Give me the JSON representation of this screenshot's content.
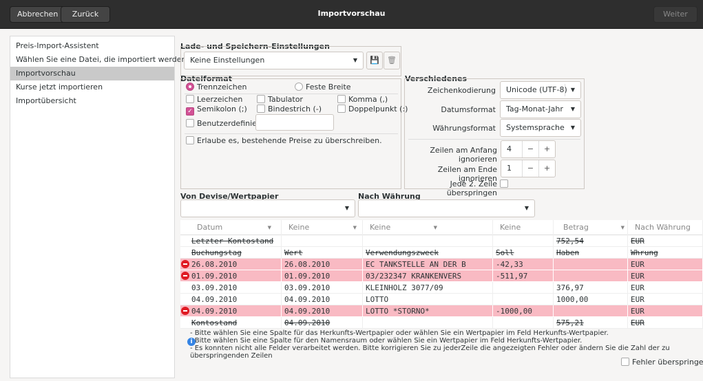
{
  "titlebar": {
    "cancel": "Abbrechen",
    "back": "Zurück",
    "title": "Importvorschau",
    "next": "Weiter"
  },
  "sidebar": {
    "items": [
      {
        "label": "Preis-Import-Assistent"
      },
      {
        "label": "Wählen Sie eine Datei, die importiert werden soll"
      },
      {
        "label": "Importvorschau"
      },
      {
        "label": "Kurse jetzt importieren"
      },
      {
        "label": "Importübersicht"
      }
    ]
  },
  "load_save": {
    "label": "Lade- und Speichern-Einstellungen",
    "value": "Keine Einstellungen"
  },
  "fileformat": {
    "label": "Dateiformat",
    "separated": "Trennzeichen",
    "fixed": "Feste Breite",
    "space": "Leerzeichen",
    "tab": "Tabulator",
    "comma": "Komma (,)",
    "semicolon": "Semikolon (;)",
    "hyphen": "Bindestrich (-)",
    "colon": "Doppelpunkt (:)",
    "custom": "Benutzerdefiniert",
    "overwrite": "Erlaube es, bestehende Preise zu überschreiben."
  },
  "misc": {
    "label": "Verschiedenes",
    "encoding_label": "Zeichenkodierung",
    "encoding_value": "Unicode (UTF-8)",
    "dateformat_label": "Datumsformat",
    "dateformat_value": "Tag-Monat-Jahr",
    "currencyformat_label": "Währungsformat",
    "currencyformat_value": "Systemsprache",
    "skip_start_label": "Zeilen am Anfang ignorieren",
    "skip_start_value": "4",
    "skip_end_label": "Zeilen am Ende ignorieren",
    "skip_end_value": "1",
    "skip_alt_label": "Jede 2. Zeile überspringen",
    "minus": "−",
    "plus": "+"
  },
  "from_commodity": {
    "label": "Von Devise/Wertpapier",
    "value": ""
  },
  "to_currency": {
    "label": "Nach Währung",
    "value": ""
  },
  "grid": {
    "headers": [
      "Datum",
      "Keine",
      "Keine",
      "Keine",
      "Betrag",
      "Nach Währung"
    ],
    "rows": [
      {
        "type": "skip",
        "cells": [
          "Letzter Kontostand",
          "",
          "",
          "",
          "752,54",
          "EUR"
        ]
      },
      {
        "type": "skip",
        "cells": [
          "Buchungstag",
          "Wert",
          "Verwendungszweck",
          "Soll",
          "Haben",
          "Whrung"
        ]
      },
      {
        "type": "error",
        "cells": [
          "26.08.2010",
          "26.08.2010",
          "EC TANKSTELLE AN DER B",
          "-42,33",
          "",
          "EUR"
        ]
      },
      {
        "type": "error",
        "cells": [
          "01.09.2010",
          "01.09.2010",
          "03/232347 KRANKENVERS",
          "-511,97",
          "",
          "EUR"
        ]
      },
      {
        "type": "ok",
        "cells": [
          "03.09.2010",
          "03.09.2010",
          "KLEINHOLZ 3077/09",
          "",
          "376,97",
          "EUR"
        ]
      },
      {
        "type": "ok",
        "cells": [
          "04.09.2010",
          "04.09.2010",
          "LOTTO",
          "",
          "1000,00",
          "EUR"
        ]
      },
      {
        "type": "error",
        "cells": [
          "04.09.2010",
          "04.09.2010",
          "LOTTO *STORNO*",
          "-1000,00",
          "",
          "EUR"
        ]
      },
      {
        "type": "skip",
        "cells": [
          "Kontostand",
          "04.09.2010",
          "",
          "",
          "575,21",
          "EUR"
        ]
      }
    ]
  },
  "messages": [
    "- Bitte wählen Sie eine Spalte für das Herkunfts-Wertpapier oder wählen Sie ein Wertpapier im Feld Herkunfts-Wertpapier.",
    "- Bitte wählen Sie eine Spalte für den Namensraum oder wählen Sie ein Wertpapier im Feld Herkunfts-Wertpapier.",
    "- Es konnten nicht alle Felder verarbeitet werden. Bitte korrigieren Sie zu jederZeile die angezeigten Fehler oder ändern Sie die Zahl der zu überspringenden Zeilen"
  ],
  "skip_errors": "Fehler überspringen"
}
